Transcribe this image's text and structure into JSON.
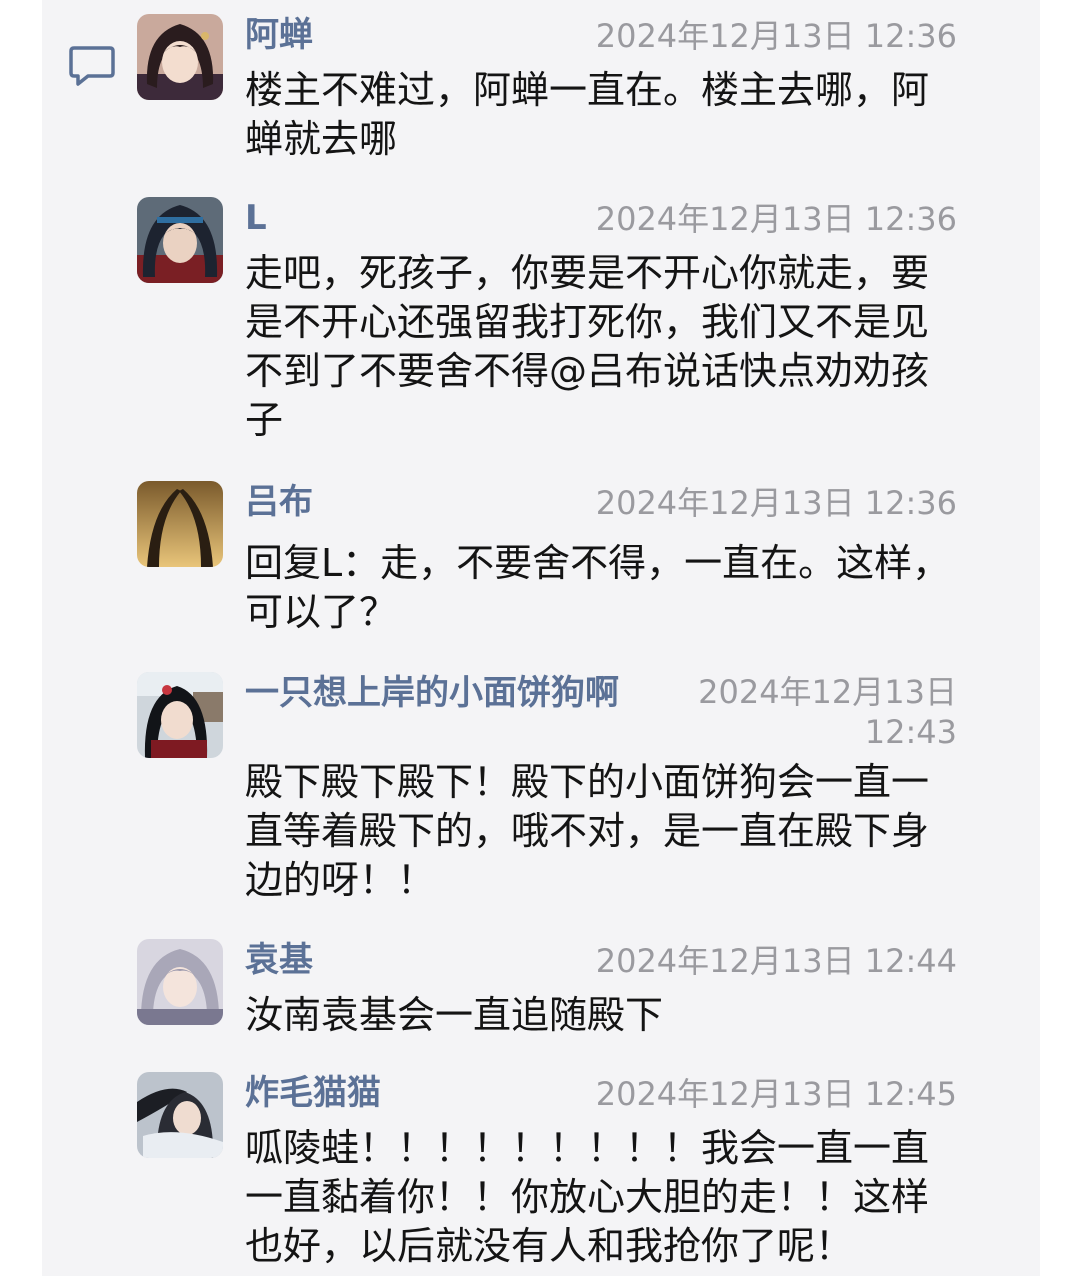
{
  "messages": [
    {
      "name": "阿蝉",
      "time": "2024年12月13日 12:36",
      "text": "楼主不难过，阿蝉一直在。楼主去哪，阿蝉就去哪"
    },
    {
      "name": "L",
      "time": "2024年12月13日 12:36",
      "text": "走吧，死孩子，你要是不开心你就走，要是不开心还强留我打死你，我们又不是见不到了不要舍不得@吕布说话快点劝劝孩子"
    },
    {
      "name": "吕布",
      "time": "2024年12月13日 12:36",
      "text": "回复L：走，不要舍不得，一直在。这样，可以了？"
    },
    {
      "name": "一只想上岸的小面饼狗啊",
      "time": "2024年12月13日 12:43",
      "text": "殿下殿下殿下！殿下的小面饼狗会一直一直等着殿下的，哦不对，是一直在殿下身边的呀！！"
    },
    {
      "name": "袁基",
      "time": "2024年12月13日 12:44",
      "text": "汝南袁基会一直追随殿下"
    },
    {
      "name": "炸毛猫猫",
      "time": "2024年12月13日 12:45",
      "text": "呱陵蛙！！！！！！！！！我会一直一直一直黏着你！！你放心大胆的走！！这样也好，以后就没有人和我抢你了呢！"
    }
  ],
  "icons": {
    "side": "comment-icon",
    "name_color": "#5b7196",
    "time_color": "#9a9a9f"
  }
}
